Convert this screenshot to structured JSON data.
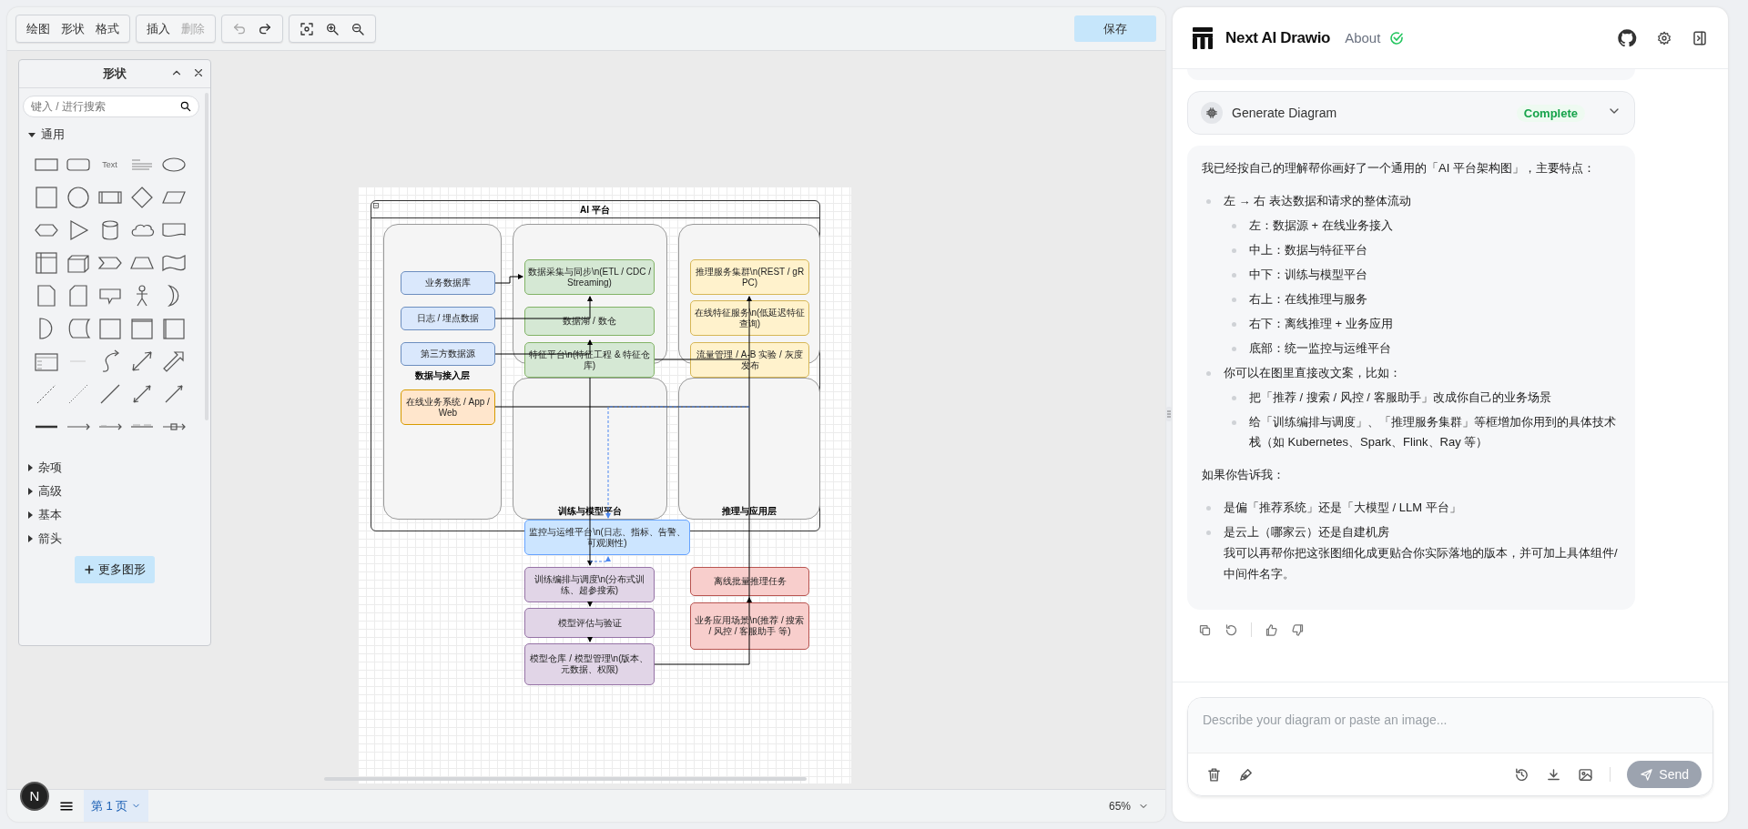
{
  "menu_buttons": [
    {
      "label": "绘图",
      "disabled": false
    },
    {
      "label": "形状",
      "disabled": false
    },
    {
      "label": "格式",
      "disabled": false
    }
  ],
  "edit_buttons": [
    {
      "label": "插入",
      "disabled": false
    },
    {
      "label": "删除",
      "disabled": true
    }
  ],
  "history_buttons": [
    {
      "kind": "undo",
      "disabled": true
    },
    {
      "kind": "redo",
      "disabled": false
    }
  ],
  "view_buttons": [
    {
      "kind": "fit"
    },
    {
      "kind": "zoom_in"
    },
    {
      "kind": "zoom_out"
    }
  ],
  "save_button": "保存",
  "shapes_panel": {
    "title": "形状",
    "search_placeholder": "键入 / 进行搜索",
    "text_tile": "Text",
    "more_button": "更多图形",
    "sections": [
      {
        "label": "通用",
        "expanded": true
      },
      {
        "label": "杂项",
        "expanded": false
      },
      {
        "label": "高级",
        "expanded": false
      },
      {
        "label": "基本",
        "expanded": false
      },
      {
        "label": "箭头",
        "expanded": false
      }
    ]
  },
  "diagram": {
    "title": "AI 平台",
    "lanes": [
      {
        "kind": "lane",
        "label": "数据与接入层"
      },
      {
        "kind": "lane"
      },
      {
        "kind": "lane"
      },
      {
        "kind": "lane",
        "label": "训练与模型平台"
      },
      {
        "kind": "lane",
        "label": "推理与应用层"
      }
    ],
    "nodes": [
      {
        "label": "业务数据库",
        "color": "#dae8fc"
      },
      {
        "label": "日志 / 埋点数据",
        "color": "#dae8fc"
      },
      {
        "label": "第三方数据源",
        "color": "#dae8fc"
      },
      {
        "label": "在线业务系统 / App / Web",
        "color": "#ffe6cc"
      },
      {
        "label": "数据采集与同步\\n(ETL / CDC / Streaming)",
        "color": "#d5e8d4"
      },
      {
        "label": "数据湖 / 数仓",
        "color": "#d5e8d4"
      },
      {
        "label": "特征平台\\n(特征工程 & 特征仓库)",
        "color": "#d5e8d4"
      },
      {
        "label": "推理服务集群\\n(REST / gRPC)",
        "color": "#fff2cc"
      },
      {
        "label": "在线特征服务\\n(低延迟特征查询)",
        "color": "#fff2cc"
      },
      {
        "label": "流量管理 / A-B 实验 / 灰度发布",
        "color": "#fff2cc"
      },
      {
        "label": "监控与运维平台\\n(日志、指标、告警、可观测性)",
        "color": "#cce5ff"
      },
      {
        "label": "训练编排与调度\\n(分布式训练、超参搜索)",
        "color": "#e1d5e7"
      },
      {
        "label": "模型评估与验证",
        "color": "#e1d5e7"
      },
      {
        "label": "模型仓库 / 模型管理\\n(版本、元数据、权限)",
        "color": "#e1d5e7"
      },
      {
        "label": "离线批量推理任务",
        "color": "#f8cecc"
      },
      {
        "label": "业务应用场景\\n(推荐 / 搜索 / 风控 / 客服助手 等)",
        "color": "#f8cecc"
      }
    ]
  },
  "avatar": "N",
  "page_tab": {
    "label": "第 1 页",
    "selected": true
  },
  "zoom": "65%",
  "app": {
    "name": "Next AI Drawio",
    "about": "About"
  },
  "tool_call": {
    "name": "Generate Diagram",
    "status": "Complete",
    "expanded": false
  },
  "message": [
    {
      "kind": "para",
      "text": "我已经按自己的理解帮你画好了一个通用的「AI 平台架构图」，主要特点："
    },
    {
      "kind": "bullet",
      "text": "左 → 右 表达数据和请求的整体流动",
      "children": [
        {
          "text": "左：数据源 + 在线业务接入"
        },
        {
          "text": "中上：数据与特征平台"
        },
        {
          "text": "中下：训练与模型平台"
        },
        {
          "text": "右上：在线推理与服务"
        },
        {
          "text": "右下：离线推理 + 业务应用"
        },
        {
          "text": "底部：统一监控与运维平台"
        }
      ]
    },
    {
      "kind": "bullet",
      "text": "你可以在图里直接改文案，比如：",
      "children": [
        {
          "text": "把「推荐 / 搜索 / 风控 / 客服助手」改成你自己的业务场景"
        },
        {
          "text": "给「训练编排与调度」、「推理服务集群」等框增加你用到的具体技术栈（如 Kubernetes、Spark、Flink、Ray 等）"
        }
      ]
    },
    {
      "kind": "para",
      "text": "如果你告诉我："
    },
    {
      "kind": "bullet",
      "text": "是偏「推荐系统」还是「大模型 / LLM 平台」"
    },
    {
      "kind": "bullet",
      "text": "是云上（哪家云）还是自建机房",
      "continuation": "我可以再帮你把这张图细化成更贴合你实际落地的版本，并可加上具体组件/中间件名字。"
    }
  ],
  "input": {
    "placeholder": "Describe your diagram or paste an image..."
  },
  "send_button": {
    "label": "Send",
    "disabled": true
  }
}
